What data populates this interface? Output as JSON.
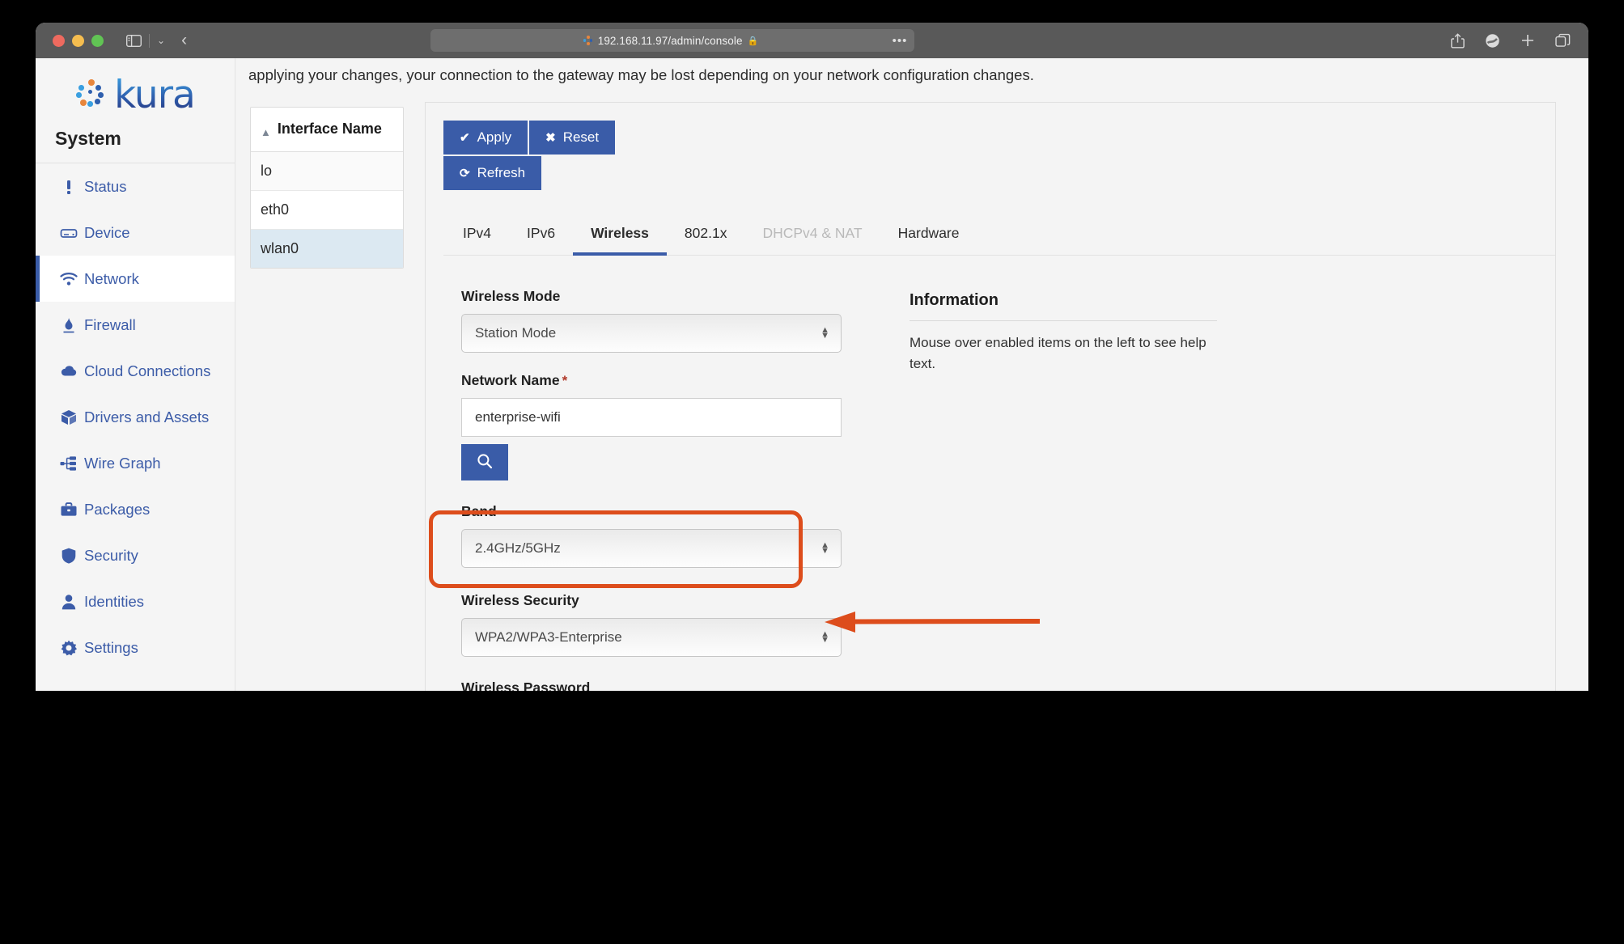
{
  "browser": {
    "url": "192.168.11.97/admin/console",
    "lock_icon": "lock-icon",
    "settings_glyph": "•••",
    "sidebar_toggle_icon": "sidebar-toggle-icon",
    "back_glyph": "‹",
    "caret_glyph": "⌄",
    "right_icons": [
      "share-icon",
      "extension-icon",
      "new-tab-icon",
      "tab-overview-icon"
    ]
  },
  "sidebar": {
    "brand": "kura",
    "section_title": "System",
    "items": [
      {
        "label": "Status",
        "icon": "exclamation-icon",
        "active": false
      },
      {
        "label": "Device",
        "icon": "server-icon",
        "active": false
      },
      {
        "label": "Network",
        "icon": "wifi-icon",
        "active": true
      },
      {
        "label": "Firewall",
        "icon": "flame-icon",
        "active": false
      },
      {
        "label": "Cloud Connections",
        "icon": "cloud-icon",
        "active": false
      },
      {
        "label": "Drivers and Assets",
        "icon": "cube-icon",
        "active": false
      },
      {
        "label": "Wire Graph",
        "icon": "sitemap-icon",
        "active": false
      },
      {
        "label": "Packages",
        "icon": "briefcase-icon",
        "active": false
      },
      {
        "label": "Security",
        "icon": "shield-icon",
        "active": false
      },
      {
        "label": "Identities",
        "icon": "user-icon",
        "active": false
      },
      {
        "label": "Settings",
        "icon": "gear-icon",
        "active": false
      }
    ]
  },
  "banner": {
    "text": "applying your changes, your connection to the gateway may be lost depending on your network configuration changes."
  },
  "interfaces": {
    "header": "Interface Name",
    "sort_caret": "▲",
    "rows": [
      {
        "name": "lo",
        "selected": false
      },
      {
        "name": "eth0",
        "selected": false
      },
      {
        "name": "wlan0",
        "selected": true
      }
    ]
  },
  "toolbar": {
    "apply_label": "Apply",
    "apply_icon": "check-icon",
    "reset_label": "Reset",
    "reset_icon": "close-icon",
    "refresh_label": "Refresh",
    "refresh_icon": "refresh-icon"
  },
  "tabs": [
    {
      "label": "IPv4",
      "active": false,
      "disabled": false
    },
    {
      "label": "IPv6",
      "active": false,
      "disabled": false
    },
    {
      "label": "Wireless",
      "active": true,
      "disabled": false
    },
    {
      "label": "802.1x",
      "active": false,
      "disabled": false
    },
    {
      "label": "DHCPv4 & NAT",
      "active": false,
      "disabled": true
    },
    {
      "label": "Hardware",
      "active": false,
      "disabled": false
    }
  ],
  "form": {
    "wireless_mode": {
      "label": "Wireless Mode",
      "value": "Station Mode"
    },
    "network_name": {
      "label": "Network Name",
      "required_mark": "*",
      "value": "enterprise-wifi"
    },
    "search_button_icon": "search-icon",
    "band": {
      "label": "Band",
      "value": "2.4GHz/5GHz"
    },
    "wireless_security": {
      "label": "Wireless Security",
      "value": "WPA2/WPA3-Enterprise"
    },
    "wireless_password": {
      "label": "Wireless Password",
      "value": "•••••••••••"
    },
    "stepper_up": "▲",
    "stepper_down": "▼"
  },
  "information": {
    "title": "Information",
    "body": "Mouse over enabled items on the left to see help text."
  },
  "annotation": {
    "highlight_color": "#dd4d1c",
    "target": "wireless-security-field"
  },
  "colors": {
    "accent_blue": "#3a5ca8",
    "selected_row": "#dce9f2",
    "annotation_orange": "#dd4d1c",
    "required_red": "#b0392a"
  }
}
